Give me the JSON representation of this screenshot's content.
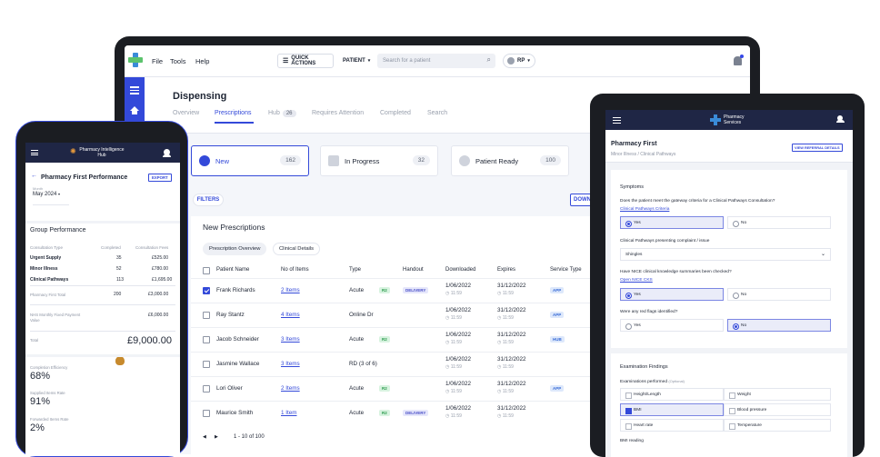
{
  "laptop": {
    "menu": [
      "File",
      "Tools",
      "Help"
    ],
    "quick_actions": "QUICK ACTIONS",
    "patient_select": "PATIENT",
    "search_placeholder": "Search for a patient",
    "user_initials": "RP",
    "page_title": "Dispensing",
    "tabs": [
      "Overview",
      "Prescriptions",
      "Hub",
      "Requires Attention",
      "Completed",
      "Search"
    ],
    "hub_count": "26",
    "stats": [
      {
        "label": "New",
        "count": "162"
      },
      {
        "label": "In Progress",
        "count": "32"
      },
      {
        "label": "Patient Ready",
        "count": "100"
      }
    ],
    "filters": "FILTERS",
    "download": "DOWN",
    "table_title": "New Prescriptions",
    "subtabs": [
      "Prescription Overview",
      "Clinical Details"
    ],
    "columns": [
      "Patient Name",
      "No of Items",
      "Type",
      "Handout",
      "Downloaded",
      "Expires",
      "Service Type"
    ],
    "rows": [
      {
        "name": "Frank Richards",
        "items": "2 Items",
        "type": "Acute",
        "type_tag": "R2",
        "handout": "DELIVERY",
        "downloaded": "1/06/2022",
        "dl_time": "11:59",
        "expires": "31/12/2022",
        "exp_time": "11:59",
        "service": "APP",
        "checked": true
      },
      {
        "name": "Ray Stantz",
        "items": "4 Items",
        "type": "Online Dr",
        "type_tag": "",
        "handout": "",
        "downloaded": "1/06/2022",
        "dl_time": "11:59",
        "expires": "31/12/2022",
        "exp_time": "11:59",
        "service": "APP",
        "checked": false
      },
      {
        "name": "Jacob Schneider",
        "items": "3 Items",
        "type": "Acute",
        "type_tag": "R2",
        "handout": "",
        "downloaded": "1/06/2022",
        "dl_time": "11:59",
        "expires": "31/12/2022",
        "exp_time": "11:59",
        "service": "HUB",
        "checked": false
      },
      {
        "name": "Jasmine Wallace",
        "items": "3 Items",
        "type": "RD (3 of 6)",
        "type_tag": "",
        "handout": "",
        "downloaded": "1/06/2022",
        "dl_time": "11:59",
        "expires": "31/12/2022",
        "exp_time": "11:59",
        "service": "",
        "checked": false
      },
      {
        "name": "Lori Oliver",
        "items": "2 Items",
        "type": "Acute",
        "type_tag": "R2",
        "handout": "",
        "downloaded": "1/06/2022",
        "dl_time": "11:59",
        "expires": "31/12/2022",
        "exp_time": "11:59",
        "service": "APP",
        "checked": false
      },
      {
        "name": "Maurice Smith",
        "items": "1 Item",
        "type": "Acute",
        "type_tag": "R2",
        "handout": "DELIVERY",
        "downloaded": "1/06/2022",
        "dl_time": "11:59",
        "expires": "31/12/2022",
        "exp_time": "11:59",
        "service": "",
        "checked": false
      }
    ],
    "pagination": "1 - 10 of 100"
  },
  "phone": {
    "app_name": "Pharmacy Intelligence Hub",
    "title": "Pharmacy First Performance",
    "export": "EXPORT",
    "month_label": "Month",
    "month": "May 2024",
    "section": "Group Performance",
    "headers": [
      "Consultation Type",
      "Completed",
      "Consultation Fees"
    ],
    "rows": [
      {
        "type": "Urgent Supply",
        "completed": "35",
        "fees": "£525.00"
      },
      {
        "type": "Minor Illness",
        "completed": "52",
        "fees": "£780.00"
      },
      {
        "type": "Clinical Pathways",
        "completed": "113",
        "fees": "£1,695.00"
      }
    ],
    "pf_total_label": "Pharmacy First Total",
    "pf_total_completed": "200",
    "pf_total_fees": "£3,000.00",
    "nhs_label": "NHS Monthly Fixed Payment Value",
    "nhs_value": "£6,000.00",
    "total_label": "Total",
    "total_value": "£9,000.00",
    "metrics": [
      {
        "label": "Completion Efficiency",
        "value": "68%"
      },
      {
        "label": "Supplied Items Rate",
        "value": "91%"
      },
      {
        "label": "Forwarded Items Rate",
        "value": "2%"
      }
    ]
  },
  "tablet": {
    "app_name": "Pharmacy Services",
    "title": "Pharmacy First",
    "breadcrumb": "Minor Illness / Clinical Pathways",
    "referral_btn": "VIEW REFERRAL DETAILS",
    "symptoms": "Symptoms",
    "q1": "Does the patient meet the gateway criteria for a Clinical Pathways Consultation?",
    "q1_link": "Clinical Pathways Criteria",
    "yes": "Yes",
    "no": "No",
    "q2": "Clinical Pathways presenting complaint / issue",
    "q2_value": "Shingles",
    "q3": "Have NICE clinical knowledge summaries been checked?",
    "q3_link": "Open NICE CKS",
    "q4": "Were any red flags identified?",
    "exam_title": "Examination Findings",
    "exam_performed": "Examinations performed",
    "optional": "(Optional)",
    "exams": [
      "Height/Length",
      "Weight",
      "BMI",
      "Blood pressure",
      "Heart rate",
      "Temperature"
    ],
    "bmi_reading": "BMI reading"
  }
}
